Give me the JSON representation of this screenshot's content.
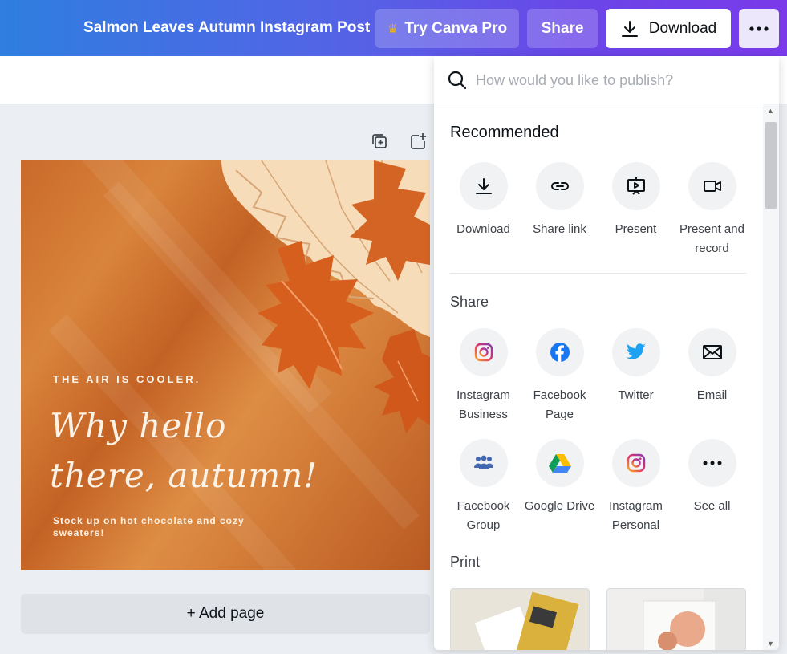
{
  "topbar": {
    "doc_title": "Salmon Leaves Autumn Instagram Post",
    "pro_label": "Try Canva Pro",
    "share_label": "Share",
    "download_label": "Download",
    "more_label": "•••"
  },
  "canvas": {
    "small_heading": "THE AIR IS COOLER.",
    "script_line1": "Why hello",
    "script_line2": "there, autumn!",
    "body_text": "Stock up on hot chocolate and cozy sweaters!"
  },
  "add_page_label": "+ Add page",
  "panel": {
    "search_placeholder": "How would you like to publish?",
    "recommended": {
      "title": "Recommended",
      "items": [
        {
          "label": "Download",
          "icon": "download-icon"
        },
        {
          "label": "Share link",
          "icon": "link-icon"
        },
        {
          "label": "Present",
          "icon": "present-icon"
        },
        {
          "label": "Present and record",
          "icon": "video-camera-icon"
        }
      ]
    },
    "share": {
      "title": "Share",
      "items": [
        {
          "label": "Instagram Business",
          "icon": "instagram-icon"
        },
        {
          "label": "Facebook Page",
          "icon": "facebook-icon"
        },
        {
          "label": "Twitter",
          "icon": "twitter-icon"
        },
        {
          "label": "Email",
          "icon": "email-icon"
        },
        {
          "label": "Facebook Group",
          "icon": "facebook-group-icon"
        },
        {
          "label": "Google Drive",
          "icon": "google-drive-icon"
        },
        {
          "label": "Instagram Personal",
          "icon": "instagram-icon"
        },
        {
          "label": "See all",
          "icon": "more-icon"
        }
      ]
    },
    "print": {
      "title": "Print"
    }
  },
  "colors": {
    "topbar_start": "#2f7ee0",
    "topbar_end": "#7a3aea",
    "crown": "#f4b400",
    "facebook": "#1877f2",
    "twitter": "#1da1f2"
  }
}
